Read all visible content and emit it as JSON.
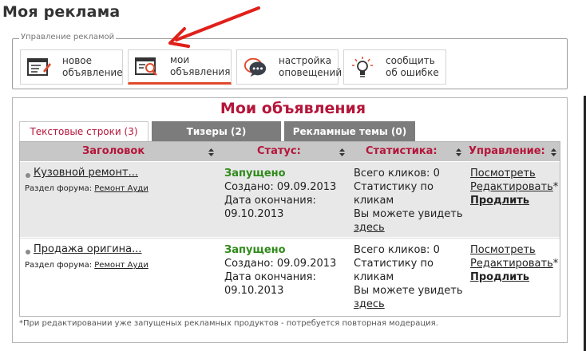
{
  "page_title": "Моя реклама",
  "toolbar": {
    "legend": "Управление рекламой",
    "buttons": [
      {
        "label": "новое\nобъявление",
        "icon": "new-ad-icon"
      },
      {
        "label": "мои\nобъявления",
        "icon": "my-ads-icon"
      },
      {
        "label": "настройка\nоповещений",
        "icon": "notifications-icon"
      },
      {
        "label": "сообщить\nоб ошибке",
        "icon": "bulb-icon"
      }
    ],
    "active_index": 1
  },
  "section_title": "Мои объявления",
  "tabs": [
    {
      "label": "Текстовые строки (3)"
    },
    {
      "label": "Тизеры (2)"
    },
    {
      "label": "Рекламные темы (0)"
    }
  ],
  "table": {
    "headers": [
      "Заголовок",
      "Статус:",
      "Статистика:",
      "Управление:"
    ],
    "rows": [
      {
        "title": "Кузовной ремонт...",
        "forum_label": "Раздел форума:",
        "forum_link": "Ремонт Ауди",
        "status": "Запущено",
        "created": "Создано: 09.09.2013",
        "end_label": "Дата окончания:",
        "end_date": "09.10.2013",
        "clicks": "Всего кликов: 0",
        "stats_text_1": "Статистику по",
        "stats_text_2": "кликам",
        "stats_text_3": "Вы можете увидеть",
        "stats_link": "здесь",
        "view": "Посмотреть",
        "edit": "Редактировать",
        "edit_star": "*",
        "extend": "Продлить"
      },
      {
        "title": "Продажа оригина...",
        "forum_label": "Раздел форума:",
        "forum_link": "Ремонт Ауди",
        "status": "Запущено",
        "created": "Создано: 09.09.2013",
        "end_label": "Дата окончания:",
        "end_date": "09.10.2013",
        "clicks": "Всего кликов: 0",
        "stats_text_1": "Статистику по",
        "stats_text_2": "кликам",
        "stats_text_3": "Вы можете увидеть",
        "stats_link": "здесь",
        "view": "Посмотреть",
        "edit": "Редактировать",
        "edit_star": "*",
        "extend": "Продлить"
      }
    ]
  },
  "footnote": "*При редактировании уже запущеных рекламных продуктов - потребуется повторная модерация.",
  "colors": {
    "accent": "#b5153a",
    "status_green": "#2f8a1a",
    "arrow_red": "#e0201a",
    "tab_gray": "#7c7c7c",
    "header_gray": "#c7c7c7"
  }
}
